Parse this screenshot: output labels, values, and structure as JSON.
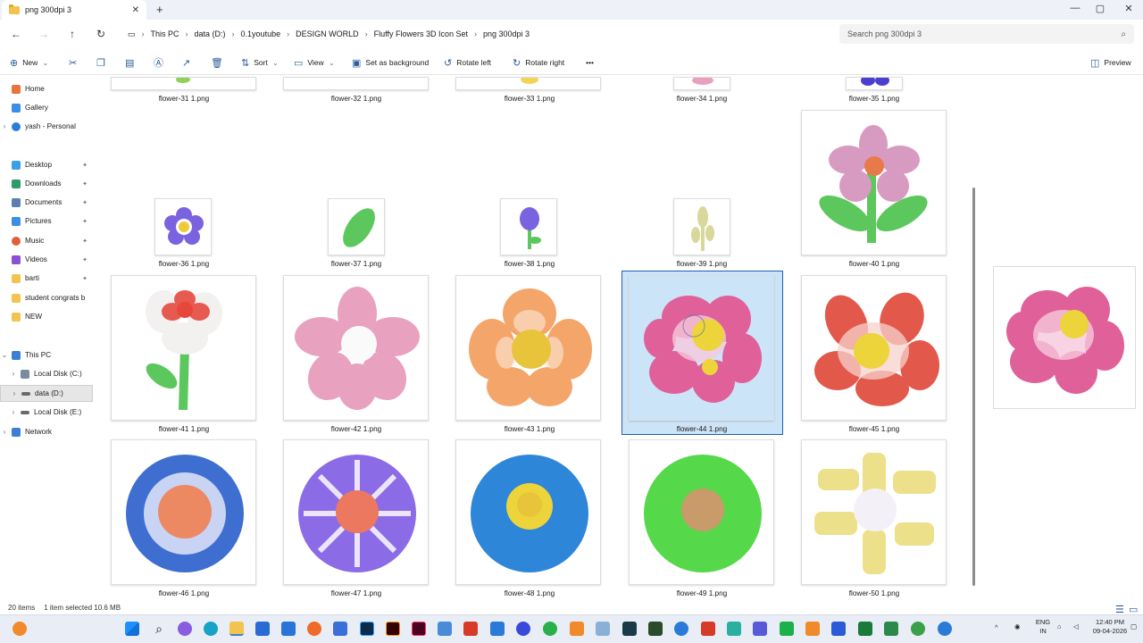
{
  "window": {
    "tab_title": "png 300dpi 3",
    "new_tab": "+",
    "controls": [
      "—",
      "▢",
      "✕"
    ]
  },
  "address": {
    "crumbs": [
      "This PC",
      "data (D:)",
      "0.1youtube",
      "DESIGN WORLD",
      "Fluffy Flowers 3D Icon Set",
      "png 300dpi 3"
    ],
    "search_placeholder": "Search png 300dpi 3"
  },
  "toolbar": {
    "new": "New",
    "sort": "Sort",
    "view": "View",
    "set_background": "Set as background",
    "rotate_left": "Rotate left",
    "rotate_right": "Rotate right",
    "more": "•••",
    "preview": "Preview"
  },
  "sidebar": {
    "home": "Home",
    "gallery": "Gallery",
    "onedrive": "yash - Personal",
    "desktop": "Desktop",
    "downloads": "Downloads",
    "documents": "Documents",
    "pictures": "Pictures",
    "music": "Music",
    "videos": "Videos",
    "barti": "barti",
    "student": "student congrats b",
    "new_folder": "NEW",
    "this_pc": "This PC",
    "local_c": "Local Disk (C:)",
    "data_d": "data (D:)",
    "local_e": "Local Disk (E:)",
    "network": "Network"
  },
  "files": {
    "f31": "flower-31 1.png",
    "f32": "flower-32 1.png",
    "f33": "flower-33 1.png",
    "f34": "flower-34 1.png",
    "f35": "flower-35 1.png",
    "f36": "flower-36 1.png",
    "f37": "flower-37 1.png",
    "f38": "flower-38 1.png",
    "f39": "flower-39 1.png",
    "f40": "flower-40 1.png",
    "f41": "flower-41 1.png",
    "f42": "flower-42 1.png",
    "f43": "flower-43 1.png",
    "f44": "flower-44 1.png",
    "f45": "flower-45 1.png",
    "f46": "flower-46 1.png",
    "f47": "flower-47 1.png",
    "f48": "flower-48 1.png",
    "f49": "flower-49 1.png",
    "f50": "flower-50 1.png"
  },
  "status": {
    "items": "20 items",
    "selected": "1 item selected  10.6 MB"
  },
  "tray": {
    "lang1": "ENG",
    "lang2": "IN",
    "time": "12:40 PM",
    "date": "09-04-2026"
  },
  "colors": {
    "accent": "#1a5fb4",
    "selection": "#cce4f7"
  }
}
